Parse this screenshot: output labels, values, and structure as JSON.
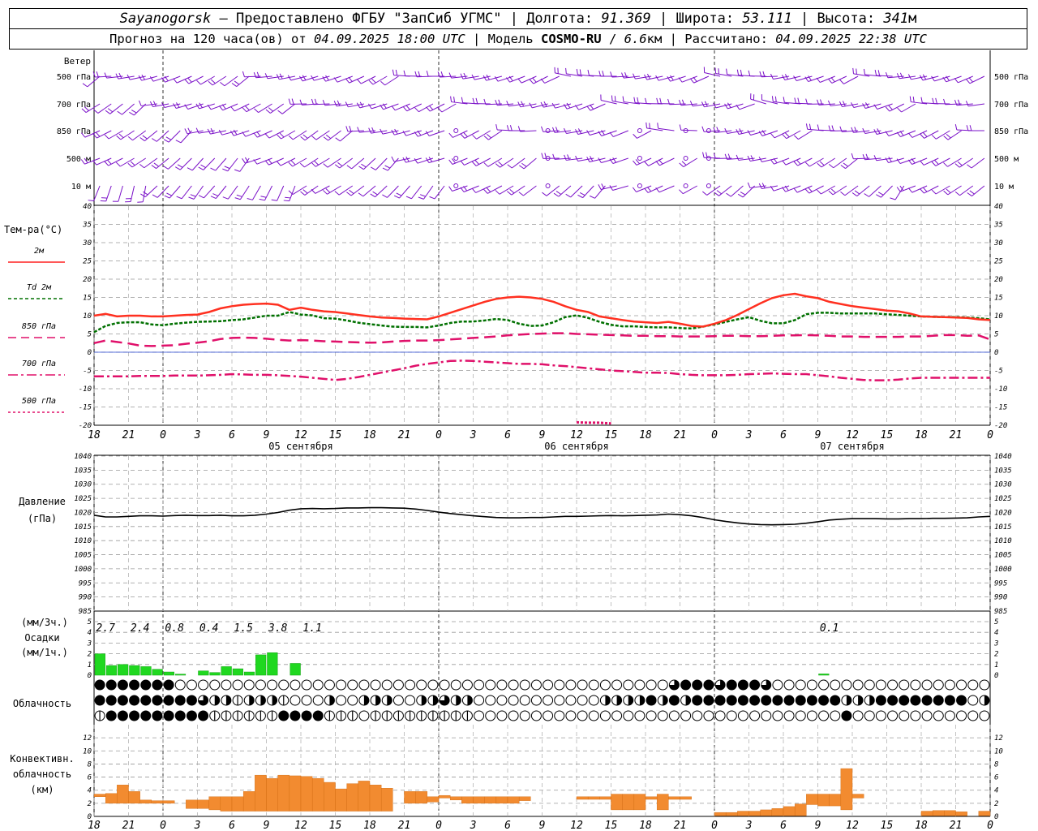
{
  "header": {
    "station": "Sayanogorsk",
    "provider_prefix": " — Предоставлено ФГБУ \"ЗапСиб УГМС\" | Долгота: ",
    "lon": "91.369",
    "lat_prefix": " | Широта: ",
    "lat": "53.111",
    "alt_prefix": " | Высота: ",
    "alt": "341",
    "alt_unit": "м",
    "line2_prefix": "Прогноз на 120 часа(ов) от ",
    "forecast_start": "04.09.2025 18:00 UTC",
    "model_prefix": " | Модель ",
    "model": "COSMO-RU",
    "model_res_sep": " / ",
    "model_res": "6.6",
    "model_res_unit": "км",
    "calc_prefix": " | Рассчитано: ",
    "calculated": "04.09.2025 22:38 UTC"
  },
  "labels": {
    "wind_title": "Ветер",
    "wind_levels": [
      "500 гПа",
      "700 гПа",
      "850 гПа",
      "500 м",
      "10  м"
    ],
    "temp_title": "Тем-ра(°C)",
    "temp_legend": [
      {
        "label": "2м",
        "color": "#ff2020",
        "dash": ""
      },
      {
        "label": "Td  2м",
        "color": "#007000",
        "dash": "4,3"
      },
      {
        "label": "850 гПа",
        "color": "#e0106a",
        "dash": "10,6"
      },
      {
        "label": "700 гПа",
        "color": "#e0106a",
        "dash": "12,4,3,4"
      },
      {
        "label": "500 гПа",
        "color": "#e0106a",
        "dash": "3,3"
      }
    ],
    "pressure_title": "Давление",
    "pressure_unit": "(гПа)",
    "precip_unit_3h": "(мм/3ч.)",
    "precip_title": "Осадки",
    "precip_unit_1h": "(мм/1ч.)",
    "cloud_title": "Облачность",
    "conv_title": "Конвективн.",
    "conv_title2": "облачность",
    "conv_unit": "(км)"
  },
  "chart_data": {
    "type": "meteogram",
    "time_labels": [
      "18",
      "21",
      "0",
      "3",
      "6",
      "9",
      "12",
      "15",
      "18",
      "21",
      "0",
      "3",
      "6",
      "9",
      "12",
      "15",
      "18",
      "21",
      "0",
      "3",
      "6",
      "9",
      "12",
      "15",
      "18",
      "21",
      "0"
    ],
    "day_labels": [
      "05 сентября",
      "06 сентября",
      "07 сентября"
    ],
    "temperature": {
      "ylim": [
        -20,
        40
      ],
      "ticks": [
        40,
        35,
        30,
        25,
        20,
        15,
        10,
        5,
        0,
        -5,
        -10,
        -15,
        -20
      ],
      "t2m": [
        10,
        10.5,
        9.8,
        10,
        10,
        9.8,
        9.8,
        10,
        10.2,
        10.3,
        11,
        12,
        12.6,
        13,
        13.2,
        13.3,
        13,
        11.6,
        12.2,
        11.6,
        11.2,
        11,
        10.6,
        10.2,
        9.8,
        9.5,
        9.4,
        9.2,
        9.1,
        9,
        9.8,
        10.8,
        11.8,
        12.8,
        13.8,
        14.6,
        15,
        15.2,
        15,
        14.6,
        13.8,
        12.6,
        11.6,
        11,
        9.8,
        9.3,
        8.8,
        8.4,
        8.2,
        8,
        8.3,
        7.8,
        7.2,
        7,
        7.8,
        8.8,
        10.2,
        11.8,
        13.4,
        14.8,
        15.6,
        16,
        15.3,
        14.8,
        13.8,
        13.2,
        12.6,
        12.2,
        11.8,
        11.4,
        11.2,
        10.6,
        9.8,
        9.7,
        9.6,
        9.5,
        9.4,
        9,
        8.8
      ],
      "td2m": [
        5.5,
        7.2,
        8,
        8.2,
        8.2,
        7.6,
        7.4,
        7.8,
        8.1,
        8.3,
        8.4,
        8.5,
        8.8,
        9,
        9.5,
        10,
        10,
        11,
        10.3,
        10.1,
        9.3,
        9.2,
        8.7,
        8.1,
        7.7,
        7.3,
        7,
        6.9,
        6.9,
        6.8,
        7.3,
        8,
        8.4,
        8.4,
        8.7,
        9.1,
        8.8,
        7.8,
        7.2,
        7.3,
        8.2,
        9.6,
        10.1,
        9.4,
        8.3,
        7.5,
        7.1,
        7.1,
        6.9,
        6.8,
        6.8,
        6.6,
        6.5,
        7,
        7.6,
        8.3,
        9,
        9.6,
        8.6,
        7.9,
        7.9,
        8.8,
        10.4,
        10.8,
        10.8,
        10.6,
        10.6,
        10.6,
        10.6,
        10.4,
        10.2,
        10,
        9.8,
        9.7,
        9.6,
        9.6,
        9.5,
        9.3,
        9
      ],
      "t850": [
        2.5,
        3.2,
        2.8,
        2.4,
        1.8,
        1.7,
        1.8,
        1.9,
        2.3,
        2.6,
        3,
        3.6,
        3.9,
        4,
        3.9,
        3.7,
        3.4,
        3.2,
        3.3,
        3.2,
        3,
        2.9,
        2.8,
        2.7,
        2.6,
        2.7,
        2.9,
        3.1,
        3.2,
        3.2,
        3.3,
        3.5,
        3.7,
        3.9,
        4.1,
        4.3,
        4.6,
        4.8,
        5,
        5.1,
        5.2,
        5.2,
        5,
        4.9,
        4.8,
        4.7,
        4.6,
        4.5,
        4.5,
        4.4,
        4.4,
        4.3,
        4.3,
        4.3,
        4.4,
        4.5,
        4.5,
        4.4,
        4.4,
        4.5,
        4.6,
        4.6,
        4.7,
        4.6,
        4.5,
        4.3,
        4.3,
        4.2,
        4.2,
        4.2,
        4.2,
        4.3,
        4.3,
        4.5,
        4.7,
        4.7,
        4.5,
        4.6,
        3.5
      ],
      "t700": [
        -6.6,
        -6.6,
        -6.6,
        -6.6,
        -6.5,
        -6.5,
        -6.5,
        -6.4,
        -6.4,
        -6.4,
        -6.3,
        -6.2,
        -6,
        -6.1,
        -6.2,
        -6.2,
        -6.3,
        -6.5,
        -6.7,
        -7,
        -7.3,
        -7.6,
        -7.3,
        -6.8,
        -6.2,
        -5.6,
        -5,
        -4.4,
        -3.7,
        -3.2,
        -2.8,
        -2.4,
        -2.3,
        -2.4,
        -2.6,
        -2.8,
        -3,
        -3.2,
        -3.2,
        -3.3,
        -3.6,
        -3.8,
        -4.1,
        -4.4,
        -4.7,
        -5,
        -5.2,
        -5.4,
        -5.6,
        -5.6,
        -5.7,
        -6,
        -6.2,
        -6.3,
        -6.3,
        -6.3,
        -6.2,
        -6,
        -5.9,
        -5.8,
        -5.9,
        -6,
        -6,
        -6.3,
        -6.6,
        -7,
        -7.3,
        -7.6,
        -7.7,
        -7.7,
        -7.5,
        -7.2,
        -7,
        -7,
        -7,
        -7,
        -7,
        -7,
        -7
      ],
      "t500": [
        null,
        null,
        null,
        null,
        null,
        null,
        null,
        null,
        null,
        null,
        null,
        null,
        null,
        null,
        null,
        null,
        null,
        null,
        null,
        null,
        null,
        null,
        null,
        null,
        null,
        null,
        null,
        null,
        null,
        null,
        null,
        null,
        null,
        null,
        null,
        null,
        null,
        null,
        null,
        null,
        null,
        null,
        -19.2,
        -19.3,
        -19.3,
        -19.5,
        null,
        null,
        null,
        null,
        null,
        null,
        null,
        null,
        null,
        null,
        null,
        null,
        null,
        null,
        null,
        null,
        null,
        null,
        null,
        null,
        null,
        null,
        null,
        null,
        null,
        null,
        null,
        null,
        null,
        null,
        null,
        null,
        null
      ]
    },
    "pressure": {
      "ylim": [
        985,
        1040
      ],
      "ticks": [
        1040,
        1035,
        1030,
        1025,
        1020,
        1015,
        1010,
        1005,
        1000,
        995,
        990,
        985
      ],
      "values": [
        1019,
        1018.4,
        1018.4,
        1018.6,
        1018.8,
        1018.8,
        1018.7,
        1018.9,
        1019,
        1018.9,
        1018.9,
        1019,
        1018.8,
        1018.8,
        1019,
        1019.4,
        1020,
        1020.8,
        1021.3,
        1021.4,
        1021.3,
        1021.4,
        1021.6,
        1021.6,
        1021.7,
        1021.7,
        1021.6,
        1021.5,
        1021.2,
        1020.7,
        1020.1,
        1019.6,
        1019.2,
        1018.8,
        1018.5,
        1018.2,
        1018.1,
        1018.1,
        1018.2,
        1018.2,
        1018.4,
        1018.6,
        1018.6,
        1018.7,
        1018.8,
        1018.9,
        1018.8,
        1018.9,
        1019,
        1019.1,
        1019.4,
        1019.2,
        1018.8,
        1018.2,
        1017.4,
        1016.8,
        1016.3,
        1015.9,
        1015.7,
        1015.6,
        1015.7,
        1015.8,
        1016.2,
        1016.7,
        1017.3,
        1017.6,
        1017.8,
        1017.8,
        1017.8,
        1017.7,
        1017.7,
        1017.8,
        1017.8,
        1017.9,
        1017.9,
        1018,
        1018.1,
        1018.4,
        1018.6
      ]
    },
    "precip_3h_labels": [
      {
        "hour": 1,
        "text": "2.7"
      },
      {
        "hour": 4,
        "text": "2.4"
      },
      {
        "hour": 7,
        "text": "0.8"
      },
      {
        "hour": 10,
        "text": "0.4"
      },
      {
        "hour": 13,
        "text": "1.5"
      },
      {
        "hour": 16,
        "text": "3.8"
      },
      {
        "hour": 19,
        "text": "1.1"
      },
      {
        "hour": 64,
        "text": "0.1"
      }
    ],
    "precip": {
      "ylim": [
        0,
        5
      ],
      "ticks": [
        5,
        4,
        3,
        2,
        1,
        0
      ],
      "hours": [
        1,
        2,
        3,
        4,
        5,
        6,
        7,
        8,
        10,
        11,
        12,
        13,
        14,
        15,
        16,
        18,
        64
      ],
      "values": [
        2,
        0.9,
        1,
        0.9,
        0.8,
        0.55,
        0.3,
        0.1,
        0.4,
        0.25,
        0.8,
        0.6,
        0.3,
        1.9,
        2.1,
        1.1,
        0.12
      ]
    },
    "cloud_rows": [
      "FFFFFFFEEEEEEEEEEEEEEEEEEEEEEEEEEEEEEEEEEEEEEEEEEETFFFTFFFTEEEEEEEEEEEEEEEEEEEEEEEEEEEEEEEEEEEEEEEEEEEEEEEEEEEEEEEEEEE",
      "FFFFFFFFFTHHQHHHQEEEHEEHHHEEHHTHHEEEEEEEEEEEHHHHFHFHFFFFFFFFFFFFFHHHFFFFFFFFEHEQFFFFFFFFFFFFFFHQQHQQHQQ",
      "QFFFFFFFFFQQQQQQFFFFQQQEQQQQQQQQQEEEEEEEEEEEEEEEEEEEEEEEEEEEEEEEEFEEEEEEEEEEEEEEEEEEEEEEEEEEFFFFFFFF"
    ],
    "convective": {
      "ylim": [
        0,
        14
      ],
      "ticks": [
        12,
        10,
        8,
        6,
        4,
        2,
        0
      ],
      "segments": [
        [
          0,
          1,
          2.2,
          3
        ],
        [
          1,
          2,
          3.5,
          2
        ],
        [
          2,
          3,
          4.8,
          2
        ],
        [
          3,
          4,
          3.8,
          2
        ],
        [
          4,
          5,
          2.5,
          2
        ],
        [
          5,
          6,
          2.2,
          2
        ],
        [
          6,
          7,
          1.8,
          2
        ],
        [
          7,
          8,
          2.5,
          1.2
        ],
        [
          8,
          9,
          2.5,
          1.2
        ],
        [
          9,
          10,
          3.0,
          1
        ],
        [
          10,
          11,
          3,
          0.8
        ],
        [
          11,
          12,
          3,
          0.8
        ],
        [
          12,
          13,
          3.8,
          0.8
        ],
        [
          13,
          14,
          6.3,
          0.8
        ],
        [
          14,
          15,
          5.8,
          0.8
        ],
        [
          15,
          16,
          6.3,
          0.8
        ],
        [
          16,
          17,
          6.2,
          0.8
        ],
        [
          17,
          18,
          6.1,
          0.8
        ],
        [
          18,
          19,
          5.8,
          0.8
        ],
        [
          19,
          20,
          5.2,
          0.8
        ],
        [
          20,
          21,
          4.2,
          0.8
        ],
        [
          21,
          22,
          5.0,
          0.8
        ],
        [
          22,
          23,
          5.4,
          0.8
        ],
        [
          23,
          24,
          4.8,
          0.8
        ],
        [
          24,
          25,
          4.3,
          0.8
        ],
        [
          25,
          26,
          3.8,
          2.0
        ],
        [
          26,
          27,
          3.8,
          2.0
        ],
        [
          27,
          28,
          3.0,
          2.2
        ],
        [
          28,
          29,
          3.2,
          2.8
        ],
        [
          29,
          30,
          3.0,
          2.5
        ],
        [
          30,
          31,
          3.0,
          2.0
        ],
        [
          31,
          32,
          3.0,
          2.0
        ],
        [
          32,
          33,
          3.0,
          2.0
        ],
        [
          33,
          34,
          3.0,
          2.0
        ],
        [
          34,
          35,
          3.0,
          2.0
        ],
        [
          35,
          36,
          3.0,
          2.4
        ],
        [
          36,
          37,
          2.8,
          2.6
        ],
        [
          37,
          38,
          2.8,
          2.6
        ],
        [
          38,
          39,
          2.8,
          2.6
        ],
        [
          39,
          40,
          3.4,
          1.0
        ],
        [
          40,
          41,
          3.4,
          1.0
        ],
        [
          41,
          42,
          3.4,
          1.0
        ],
        [
          42,
          43,
          2.8,
          2.6
        ],
        [
          43,
          44,
          3.4,
          1.0
        ],
        [
          44,
          45,
          2.8,
          2.6
        ],
        [
          45,
          46,
          2.8,
          2.6
        ],
        [
          46,
          47,
          2.8,
          2.6
        ],
        [
          47,
          48,
          3.0,
          1.0
        ],
        [
          48,
          49,
          3.0,
          1.0
        ],
        [
          49,
          50,
          3.0,
          1.0
        ],
        [
          50,
          51,
          3.0,
          1.0
        ],
        [
          51,
          52,
          3.0,
          1.0
        ],
        [
          52,
          53,
          3.0,
          1.0
        ],
        [
          53,
          54,
          3.4,
          2.0
        ],
        [
          54,
          55,
          3.4,
          2.0
        ],
        [
          55,
          56,
          3.0,
          2.4
        ],
        [
          56,
          57,
          3.2,
          1.0
        ],
        [
          57,
          58,
          3.2,
          2.4
        ],
        [
          58,
          59,
          3.2,
          1.0
        ],
        [
          59,
          60,
          3.2,
          1.0
        ],
        [
          60,
          61,
          3.2,
          2.2
        ],
        [
          61,
          62,
          3.2,
          2.2
        ],
        [
          62,
          63,
          3.0,
          1.2
        ],
        [
          63,
          64,
          3.4,
          2.0
        ],
        [
          64,
          65,
          3.0,
          2.4
        ],
        [
          65,
          66,
          2.8,
          1.0
        ],
        [
          66,
          67,
          3.0,
          2.6
        ],
        [
          67,
          68,
          3.2,
          2.0
        ],
        [
          68,
          69,
          3.8,
          2.0
        ],
        [
          69,
          70,
          3.4,
          1.5
        ],
        [
          70,
          71,
          3.4,
          1.0
        ],
        [
          71,
          72,
          3.0,
          1.4
        ],
        [
          72,
          73,
          2.8,
          1.0
        ],
        [
          73,
          74,
          3.4,
          1.4
        ],
        [
          74,
          75,
          3.6,
          2.0
        ]
      ],
      "segments_day3": [
        [
          0,
          1,
          0.6,
          0.1
        ],
        [
          1,
          2,
          0.6,
          0.1
        ],
        [
          2,
          3,
          0.8,
          0.1
        ],
        [
          3,
          4,
          0.8,
          0.1
        ],
        [
          4,
          5,
          1.0,
          0.1
        ],
        [
          5,
          6,
          1.2,
          0.1
        ],
        [
          6,
          7,
          1.5,
          0.1
        ],
        [
          7,
          8,
          1.9,
          0.1
        ],
        [
          8,
          9,
          3.4,
          1.8
        ],
        [
          9,
          10,
          3.4,
          1.6
        ],
        [
          10,
          11,
          3.4,
          1.6
        ],
        [
          11,
          12,
          7.3,
          1.0
        ],
        [
          12,
          13,
          3.4,
          2.8
        ],
        [
          18,
          19,
          0.8,
          0.1
        ],
        [
          19,
          20,
          0.9,
          0.1
        ],
        [
          20,
          21,
          0.9,
          0.1
        ],
        [
          21,
          22,
          0.7,
          0.1
        ],
        [
          23,
          24,
          0.8,
          0.1
        ]
      ]
    }
  }
}
